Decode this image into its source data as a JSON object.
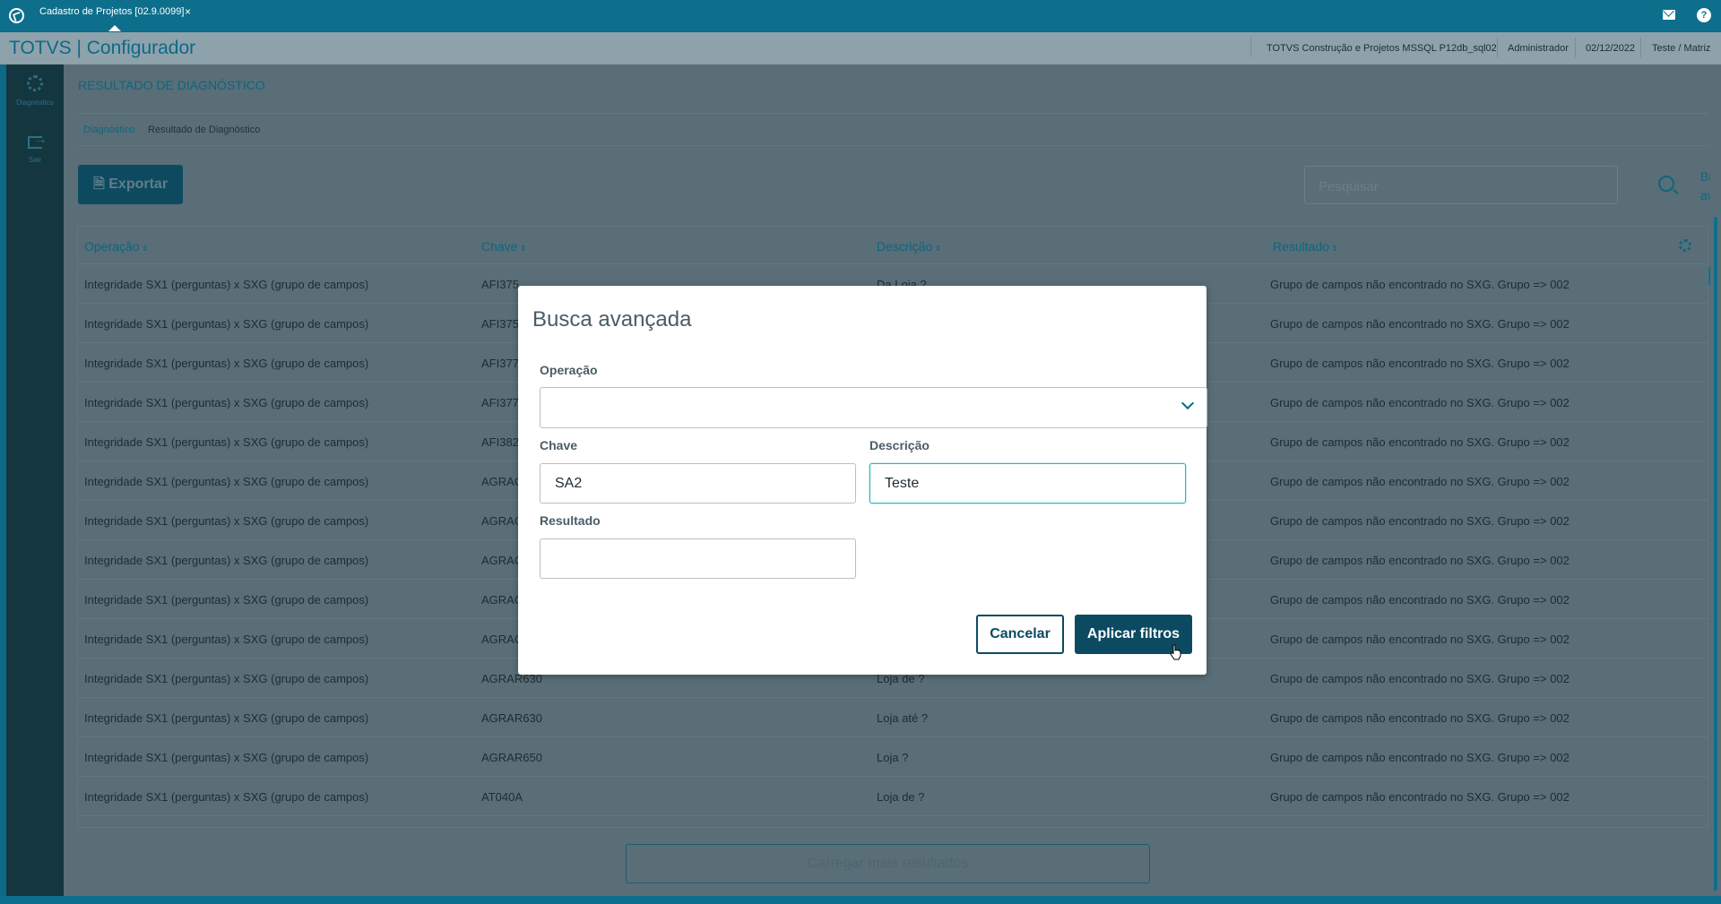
{
  "topbar": {
    "tab_label": "Cadastro de Projetos [02.9.0099]",
    "tab_close": "×"
  },
  "header": {
    "brand": "TOTVS | Configurador",
    "environment": "TOTVS Construção e Projetos MSSQL P12db_sql02",
    "user": "Administrador",
    "date": "02/12/2022",
    "branch": "Teste / Matriz"
  },
  "leftnav": {
    "items": [
      {
        "label": "Diagnóstico",
        "icon": "gear-icon"
      },
      {
        "label": "Sair",
        "icon": "exit-icon"
      }
    ]
  },
  "main": {
    "page_title": "RESULTADO DE DIAGNÓSTICO",
    "breadcrumb": [
      "Diagnóstico",
      "Resultado de Diagnóstico"
    ],
    "export_label": "Exportar",
    "search_placeholder": "Pesquisar",
    "advanced_search_label": "Busca avançada",
    "columns": [
      "Operação",
      "Chave",
      "Descrição",
      "Resultado"
    ],
    "rows": [
      {
        "op": "Integridade SX1 (perguntas) x SXG (grupo de campos)",
        "key": "AFI375",
        "desc": "Da Loja ?",
        "result": "Grupo de campos não encontrado no SXG. Grupo => 002"
      },
      {
        "op": "Integridade SX1 (perguntas) x SXG (grupo de campos)",
        "key": "AFI375",
        "desc": "",
        "result": "Grupo de campos não encontrado no SXG. Grupo => 002"
      },
      {
        "op": "Integridade SX1 (perguntas) x SXG (grupo de campos)",
        "key": "AFI377",
        "desc": "",
        "result": "Grupo de campos não encontrado no SXG. Grupo => 002"
      },
      {
        "op": "Integridade SX1 (perguntas) x SXG (grupo de campos)",
        "key": "AFI377",
        "desc": "",
        "result": "Grupo de campos não encontrado no SXG. Grupo => 002"
      },
      {
        "op": "Integridade SX1 (perguntas) x SXG (grupo de campos)",
        "key": "AFI382",
        "desc": "",
        "result": "Grupo de campos não encontrado no SXG. Grupo => 002"
      },
      {
        "op": "Integridade SX1 (perguntas) x SXG (grupo de campos)",
        "key": "AGRAC",
        "desc": "",
        "result": "Grupo de campos não encontrado no SXG. Grupo => 002"
      },
      {
        "op": "Integridade SX1 (perguntas) x SXG (grupo de campos)",
        "key": "AGRAC",
        "desc": "",
        "result": "Grupo de campos não encontrado no SXG. Grupo => 002"
      },
      {
        "op": "Integridade SX1 (perguntas) x SXG (grupo de campos)",
        "key": "AGRAC",
        "desc": "",
        "result": "Grupo de campos não encontrado no SXG. Grupo => 002"
      },
      {
        "op": "Integridade SX1 (perguntas) x SXG (grupo de campos)",
        "key": "AGRAC",
        "desc": "",
        "result": "Grupo de campos não encontrado no SXG. Grupo => 002"
      },
      {
        "op": "Integridade SX1 (perguntas) x SXG (grupo de campos)",
        "key": "AGRAC",
        "desc": "",
        "result": "Grupo de campos não encontrado no SXG. Grupo => 002"
      },
      {
        "op": "Integridade SX1 (perguntas) x SXG (grupo de campos)",
        "key": "AGRAR630",
        "desc": "Loja de ?",
        "result": "Grupo de campos não encontrado no SXG. Grupo => 002"
      },
      {
        "op": "Integridade SX1 (perguntas) x SXG (grupo de campos)",
        "key": "AGRAR630",
        "desc": "Loja até ?",
        "result": "Grupo de campos não encontrado no SXG. Grupo => 002"
      },
      {
        "op": "Integridade SX1 (perguntas) x SXG (grupo de campos)",
        "key": "AGRAR650",
        "desc": "Loja ?",
        "result": "Grupo de campos não encontrado no SXG. Grupo => 002"
      },
      {
        "op": "Integridade SX1 (perguntas) x SXG (grupo de campos)",
        "key": "AT040A",
        "desc": "Loja de ?",
        "result": "Grupo de campos não encontrado no SXG. Grupo => 002"
      }
    ],
    "load_more_label": "Carregar mais resultados"
  },
  "modal": {
    "title": "Busca avançada",
    "operacao_label": "Operação",
    "operacao_value": "",
    "chave_label": "Chave",
    "chave_value": "SA2",
    "descricao_label": "Descrição",
    "descricao_value": "Teste",
    "resultado_label": "Resultado",
    "resultado_value": "",
    "cancel_label": "Cancelar",
    "apply_label": "Aplicar filtros"
  },
  "colors": {
    "brand": "#0c6a86",
    "primary_button": "#0c4a62",
    "focus_border": "#29b6c5"
  }
}
